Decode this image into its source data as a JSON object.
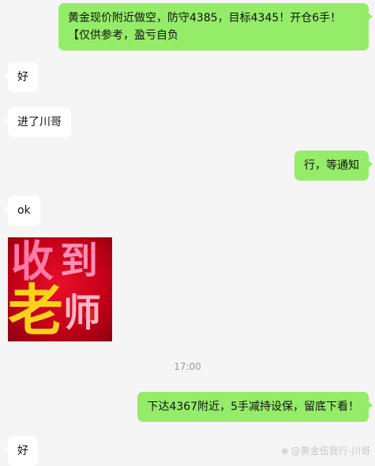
{
  "messages": {
    "m1": "黄金现价附近做空，防守4385，目标4345！开仓6手！【仅供参考，盈亏自负",
    "m2": "好",
    "m3": "进了川哥",
    "m4": "行，等通知",
    "m5": "ok",
    "m7": "下达4367附近，5手减持设保，留底下看！",
    "m8": "好"
  },
  "sticker": {
    "chars": [
      "收",
      "到",
      "老",
      "师"
    ]
  },
  "timestamp": "17:00",
  "watermark": {
    "icon": "weibo-icon",
    "text": "@黄金伍我行-川哥"
  }
}
